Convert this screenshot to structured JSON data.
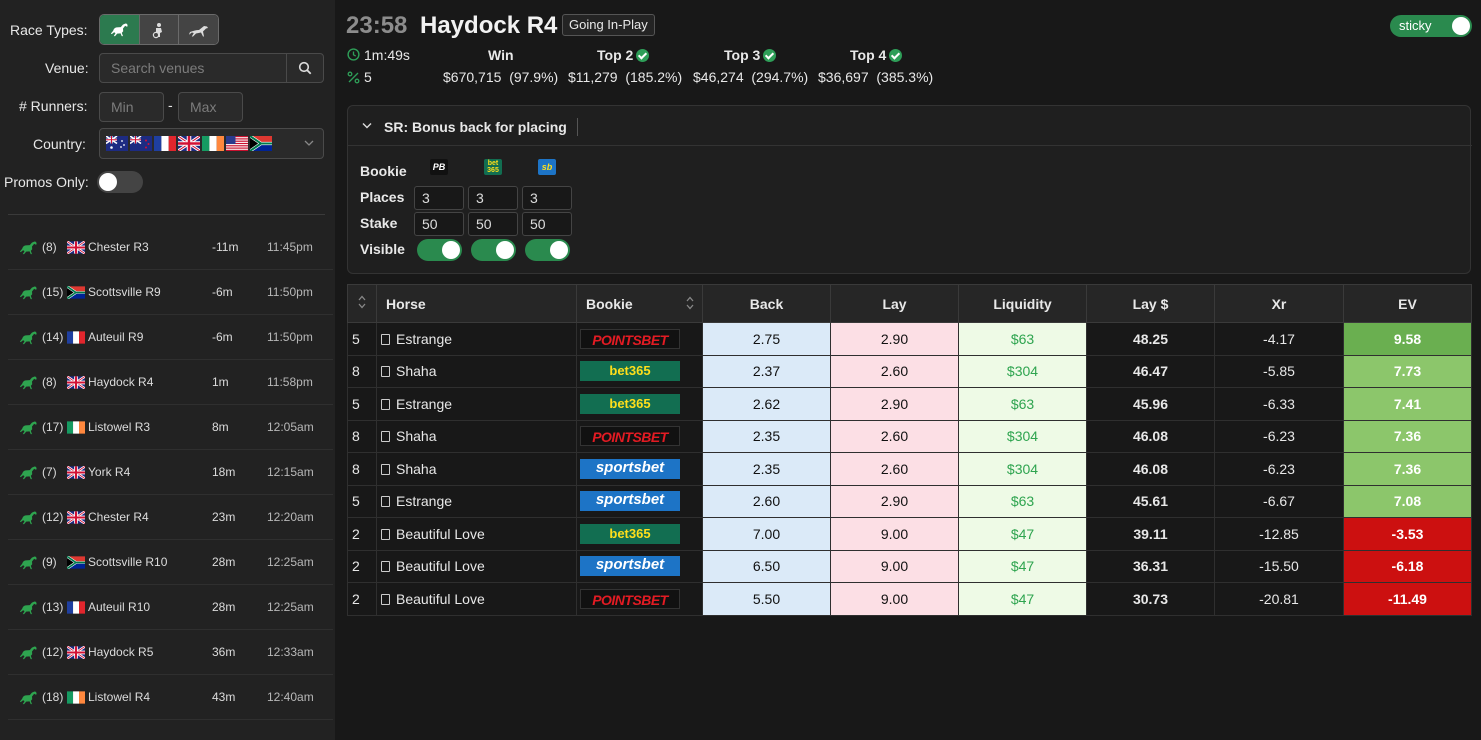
{
  "sidebar": {
    "race_types_label": "Race Types:",
    "race_types": [
      {
        "icon": "horse-racing-icon",
        "active": true
      },
      {
        "icon": "harness-racing-icon",
        "active": false
      },
      {
        "icon": "greyhound-icon",
        "active": false
      }
    ],
    "venue_label": "Venue:",
    "venue_placeholder": "Search venues",
    "runners_label": "# Runners:",
    "runners_min_placeholder": "Min",
    "runners_max_placeholder": "Max",
    "runners_dash": "-",
    "country_label": "Country:",
    "countries": [
      "AU",
      "NZ",
      "FR",
      "GB",
      "IE",
      "US",
      "ZA"
    ],
    "promos_label": "Promos Only:",
    "promos_only": false,
    "races": [
      {
        "runners": "(8)",
        "flag": "GB",
        "name": "Chester R3",
        "time_to": "-11m",
        "clock": "11:45pm"
      },
      {
        "runners": "(15)",
        "flag": "ZA",
        "name": "Scottsville R9",
        "time_to": "-6m",
        "clock": "11:50pm"
      },
      {
        "runners": "(14)",
        "flag": "FR",
        "name": "Auteuil R9",
        "time_to": "-6m",
        "clock": "11:50pm"
      },
      {
        "runners": "(8)",
        "flag": "GB",
        "name": "Haydock R4",
        "time_to": "1m",
        "clock": "11:58pm"
      },
      {
        "runners": "(17)",
        "flag": "IE",
        "name": "Listowel R3",
        "time_to": "8m",
        "clock": "12:05am"
      },
      {
        "runners": "(7)",
        "flag": "GB",
        "name": "York R4",
        "time_to": "18m",
        "clock": "12:15am"
      },
      {
        "runners": "(12)",
        "flag": "GB",
        "name": "Chester R4",
        "time_to": "23m",
        "clock": "12:20am"
      },
      {
        "runners": "(9)",
        "flag": "ZA",
        "name": "Scottsville R10",
        "time_to": "28m",
        "clock": "12:25am"
      },
      {
        "runners": "(13)",
        "flag": "FR",
        "name": "Auteuil R10",
        "time_to": "28m",
        "clock": "12:25am"
      },
      {
        "runners": "(12)",
        "flag": "GB",
        "name": "Haydock R5",
        "time_to": "36m",
        "clock": "12:33am"
      },
      {
        "runners": "(18)",
        "flag": "IE",
        "name": "Listowel R4",
        "time_to": "43m",
        "clock": "12:40am"
      }
    ]
  },
  "header": {
    "clock": "23:58",
    "title": "Haydock R4",
    "status": "Going In-Play",
    "sticky_label": "sticky",
    "sticky_on": true
  },
  "stats": {
    "countdown": "1m:49s",
    "percent": "5",
    "win_label": "Win",
    "top2_label": "Top 2",
    "top3_label": "Top 3",
    "top4_label": "Top 4",
    "win_value": "$670,715",
    "win_pct": "(97.9%)",
    "top2_value": "$11,279",
    "top2_pct": "(185.2%)",
    "top3_value": "$46,274",
    "top3_pct": "(294.7%)",
    "top4_value": "$36,697",
    "top4_pct": "(385.3%)"
  },
  "promo": {
    "title": "SR: Bonus back for placing",
    "bookie_label": "Bookie",
    "places_label": "Places",
    "stake_label": "Stake",
    "visible_label": "Visible",
    "bookies": [
      {
        "name": "PB",
        "places": "3",
        "stake": "50",
        "visible": true
      },
      {
        "name": "bet365",
        "places": "3",
        "stake": "50",
        "visible": true
      },
      {
        "name": "sb",
        "places": "3",
        "stake": "50",
        "visible": true
      }
    ]
  },
  "table": {
    "headers": {
      "horse": "Horse",
      "bookie": "Bookie",
      "back": "Back",
      "lay": "Lay",
      "liquidity": "Liquidity",
      "lay_stake": "Lay $",
      "xr": "Xr",
      "ev": "EV"
    },
    "rows": [
      {
        "num": "5",
        "horse": "Estrange",
        "bookie": "POINTSBET",
        "bk": "pb",
        "back": "2.75",
        "lay": "2.90",
        "liquidity": "$63",
        "lay_stake": "48.25",
        "xr": "-4.17",
        "ev": "9.58",
        "ev_color": "#6aaf50"
      },
      {
        "num": "8",
        "horse": "Shaha",
        "bookie": "bet365",
        "bk": "b365",
        "back": "2.37",
        "lay": "2.60",
        "liquidity": "$304",
        "lay_stake": "46.47",
        "xr": "-5.85",
        "ev": "7.73",
        "ev_color": "#8cc66b"
      },
      {
        "num": "5",
        "horse": "Estrange",
        "bookie": "bet365",
        "bk": "b365",
        "back": "2.62",
        "lay": "2.90",
        "liquidity": "$63",
        "lay_stake": "45.96",
        "xr": "-6.33",
        "ev": "7.41",
        "ev_color": "#8cc66b"
      },
      {
        "num": "8",
        "horse": "Shaha",
        "bookie": "POINTSBET",
        "bk": "pb",
        "back": "2.35",
        "lay": "2.60",
        "liquidity": "$304",
        "lay_stake": "46.08",
        "xr": "-6.23",
        "ev": "7.36",
        "ev_color": "#8cc66b"
      },
      {
        "num": "8",
        "horse": "Shaha",
        "bookie": "sportsbet",
        "bk": "sb",
        "back": "2.35",
        "lay": "2.60",
        "liquidity": "$304",
        "lay_stake": "46.08",
        "xr": "-6.23",
        "ev": "7.36",
        "ev_color": "#8cc66b"
      },
      {
        "num": "5",
        "horse": "Estrange",
        "bookie": "sportsbet",
        "bk": "sb",
        "back": "2.60",
        "lay": "2.90",
        "liquidity": "$63",
        "lay_stake": "45.61",
        "xr": "-6.67",
        "ev": "7.08",
        "ev_color": "#8cc66b"
      },
      {
        "num": "2",
        "horse": "Beautiful Love",
        "bookie": "bet365",
        "bk": "b365",
        "back": "7.00",
        "lay": "9.00",
        "liquidity": "$47",
        "lay_stake": "39.11",
        "xr": "-12.85",
        "ev": "-3.53",
        "ev_color": "#cc1010"
      },
      {
        "num": "2",
        "horse": "Beautiful Love",
        "bookie": "sportsbet",
        "bk": "sb",
        "back": "6.50",
        "lay": "9.00",
        "liquidity": "$47",
        "lay_stake": "36.31",
        "xr": "-15.50",
        "ev": "-6.18",
        "ev_color": "#cc1010"
      },
      {
        "num": "2",
        "horse": "Beautiful Love",
        "bookie": "POINTSBET",
        "bk": "pb",
        "back": "5.50",
        "lay": "9.00",
        "liquidity": "$47",
        "lay_stake": "30.73",
        "xr": "-20.81",
        "ev": "-11.49",
        "ev_color": "#cc1010"
      }
    ]
  },
  "colors": {
    "accent_green": "#2a8a4e",
    "back_bg": "#dbeaf8",
    "lay_bg": "#fcdfe5",
    "liquidity_bg": "#eefae6"
  }
}
